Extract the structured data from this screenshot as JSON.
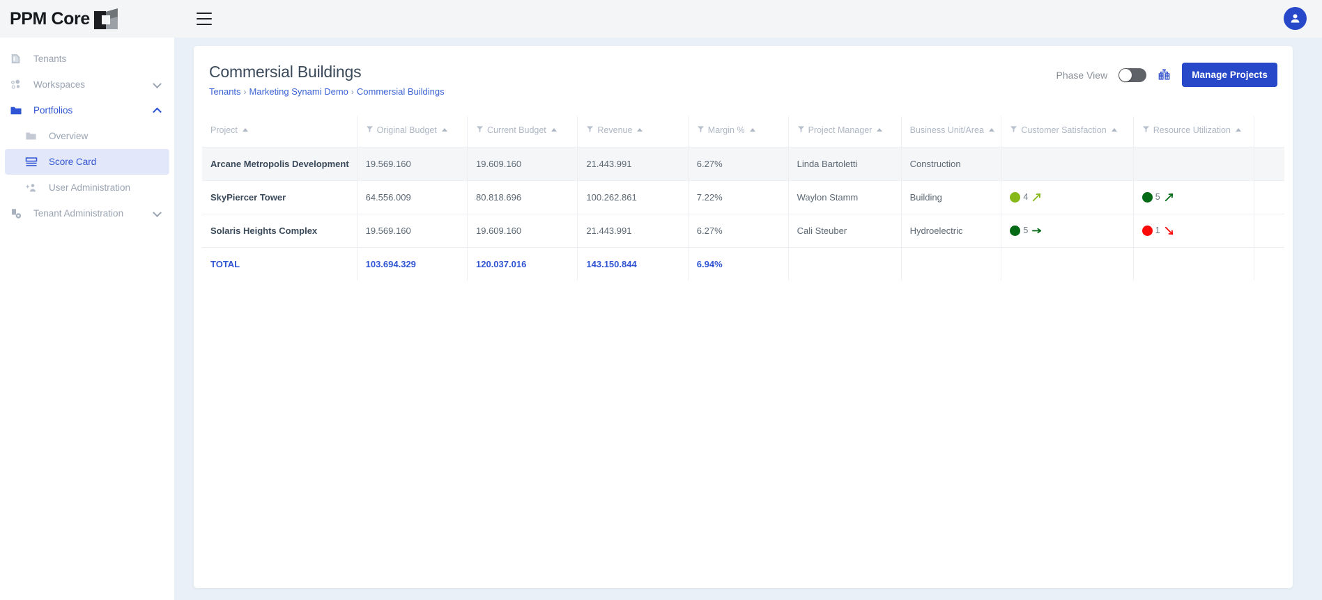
{
  "app": {
    "logo_text": "PPM Core",
    "menu_icon": "hamburger-icon",
    "avatar_icon": "user-avatar-icon"
  },
  "sidebar": {
    "items": [
      {
        "label": "Tenants",
        "icon": "tenant-box-icon",
        "level": 0,
        "state": "default",
        "chevron": "none"
      },
      {
        "label": "Workspaces",
        "icon": "workspaces-nodes-icon",
        "level": 0,
        "state": "default",
        "chevron": "down"
      },
      {
        "label": "Portfolios",
        "icon": "folder-filled-icon",
        "level": 0,
        "state": "expanded",
        "chevron": "up"
      },
      {
        "label": "Overview",
        "icon": "folder-icon",
        "level": 1,
        "state": "default",
        "chevron": "none"
      },
      {
        "label": "Score Card",
        "icon": "scorecard-lines-icon",
        "level": 1,
        "state": "selected",
        "chevron": "none"
      },
      {
        "label": "User Administration",
        "icon": "add-user-icon",
        "level": 1,
        "state": "default",
        "chevron": "none"
      },
      {
        "label": "Tenant Administration",
        "icon": "building-gear-icon",
        "level": 0,
        "state": "default",
        "chevron": "down"
      }
    ]
  },
  "header": {
    "title": "Commersial Buildings",
    "breadcrumb": [
      {
        "label": "Tenants",
        "sep": "›"
      },
      {
        "label": "Marketing Synami Demo",
        "sep": "›"
      },
      {
        "label": "Commersial Buildings",
        "sep": ""
      }
    ],
    "phase_view_label": "Phase View",
    "phase_view_on": false,
    "org_chart_icon": "org-chart-icon",
    "manage_projects_label": "Manage Projects",
    "accent_color": "#2748c8",
    "link_color": "#3a63d6"
  },
  "table": {
    "columns": [
      {
        "label": "Project",
        "filter": false,
        "sort": "asc"
      },
      {
        "label": "Original Budget",
        "filter": true,
        "sort": "asc"
      },
      {
        "label": "Current Budget",
        "filter": true,
        "sort": "asc"
      },
      {
        "label": "Revenue",
        "filter": true,
        "sort": "asc"
      },
      {
        "label": "Margin %",
        "filter": true,
        "sort": "asc"
      },
      {
        "label": "Project Manager",
        "filter": true,
        "sort": "asc"
      },
      {
        "label": "Business Unit/Area",
        "filter": false,
        "sort": "asc"
      },
      {
        "label": "Customer Satisfaction",
        "filter": true,
        "sort": "asc"
      },
      {
        "label": "Resource Utilization",
        "filter": true,
        "sort": "asc"
      }
    ],
    "rows": [
      {
        "project": "Arcane Metropolis Development",
        "original_budget": "19.569.160",
        "current_budget": "19.609.160",
        "revenue": "21.443.991",
        "margin": "6.27%",
        "project_manager": "Linda Bartoletti",
        "business_unit": "Construction",
        "customer_satisfaction": {
          "value": "",
          "color": "",
          "trend": ""
        },
        "resource_utilization": {
          "value": "",
          "color": "",
          "trend": ""
        },
        "shaded": true
      },
      {
        "project": "SkyPiercer Tower",
        "original_budget": "64.556.009",
        "current_budget": "80.818.696",
        "revenue": "100.262.861",
        "margin": "7.22%",
        "project_manager": "Waylon Stamm",
        "business_unit": "Building",
        "customer_satisfaction": {
          "value": "4",
          "color": "#86b81a",
          "trend": "up"
        },
        "resource_utilization": {
          "value": "5",
          "color": "#046a16",
          "trend": "up"
        },
        "shaded": false
      },
      {
        "project": "Solaris Heights Complex",
        "original_budget": "19.569.160",
        "current_budget": "19.609.160",
        "revenue": "21.443.991",
        "margin": "6.27%",
        "project_manager": "Cali Steuber",
        "business_unit": "Hydroelectric",
        "customer_satisfaction": {
          "value": "5",
          "color": "#046a16",
          "trend": "flat"
        },
        "resource_utilization": {
          "value": "1",
          "color": "#fb0a0a",
          "trend": "down"
        },
        "shaded": false
      }
    ],
    "total": {
      "project": "TOTAL",
      "original_budget": "103.694.329",
      "current_budget": "120.037.016",
      "revenue": "143.150.844",
      "margin": "6.94%",
      "project_manager": "",
      "business_unit": "",
      "customer_satisfaction": "",
      "resource_utilization": ""
    }
  }
}
